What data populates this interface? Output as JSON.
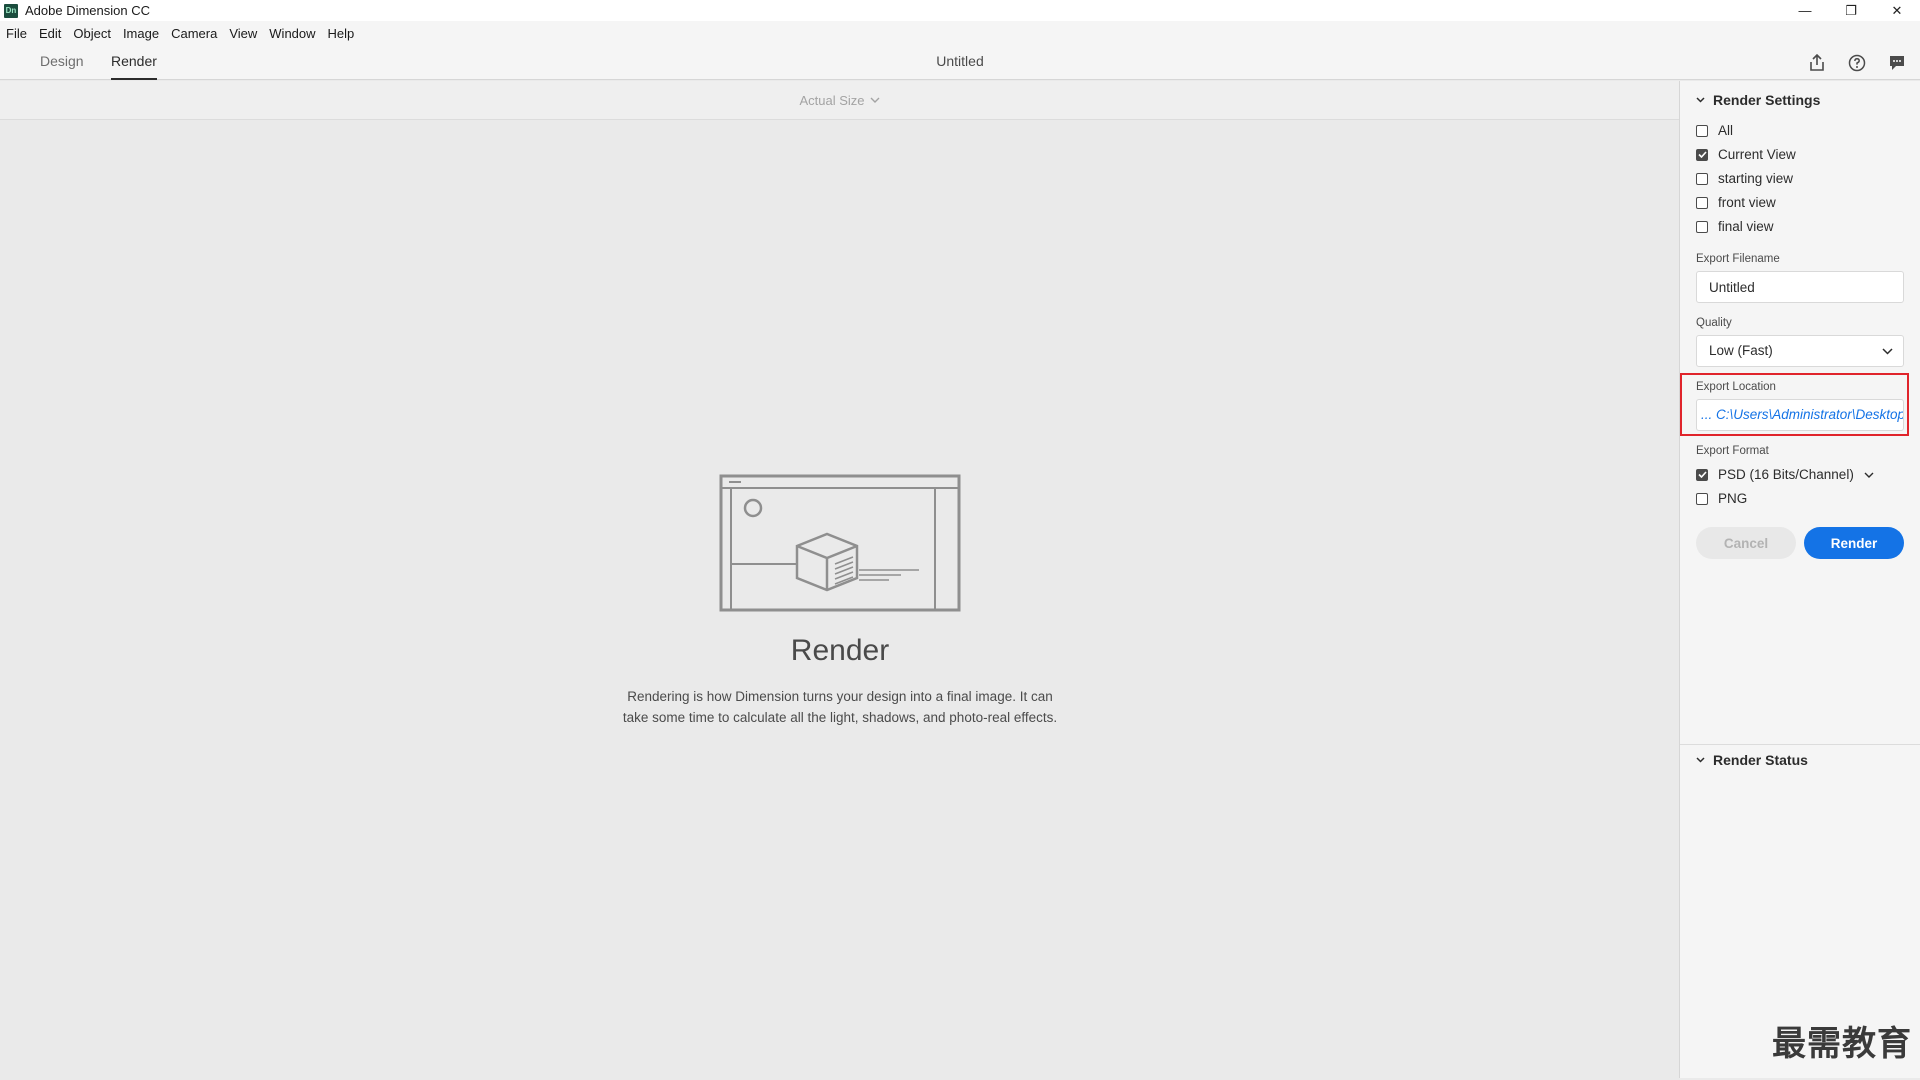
{
  "window": {
    "app_icon_text": "Dn",
    "title": "Adobe Dimension CC",
    "controls": [
      "—",
      "❐",
      "✕"
    ]
  },
  "menu": [
    "File",
    "Edit",
    "Object",
    "Image",
    "Camera",
    "View",
    "Window",
    "Help"
  ],
  "tabs": [
    {
      "label": "Design",
      "active": false
    },
    {
      "label": "Render",
      "active": true
    }
  ],
  "document_title": "Untitled",
  "header_icons": [
    "share-icon",
    "help-icon",
    "comment-icon"
  ],
  "canvas": {
    "zoom_label": "Actual Size",
    "empty_state": {
      "title": "Render",
      "line1": "Rendering is how Dimension turns your design into a final image. It can",
      "line2": "take some time to calculate all the light, shadows, and photo-real effects."
    }
  },
  "render_settings": {
    "heading": "Render Settings",
    "views": [
      {
        "label": "All",
        "checked": false
      },
      {
        "label": "Current View",
        "checked": true
      },
      {
        "label": "starting view",
        "checked": false
      },
      {
        "label": "front view",
        "checked": false
      },
      {
        "label": "final view",
        "checked": false
      }
    ],
    "export_filename_label": "Export Filename",
    "export_filename_value": "Untitled",
    "quality_label": "Quality",
    "quality_value": "Low (Fast)",
    "export_location_label": "Export Location",
    "export_location_value": "... C:\\Users\\Administrator\\Desktop",
    "export_format_label": "Export Format",
    "formats": [
      {
        "label": "PSD (16 Bits/Channel)",
        "checked": true,
        "has_dropdown": true
      },
      {
        "label": "PNG",
        "checked": false,
        "has_dropdown": false
      }
    ],
    "cancel_label": "Cancel",
    "render_label": "Render"
  },
  "render_status": {
    "heading": "Render Status"
  },
  "watermark": "最需教育",
  "colors": {
    "accent": "#1473e6",
    "highlight": "#e0242b"
  }
}
